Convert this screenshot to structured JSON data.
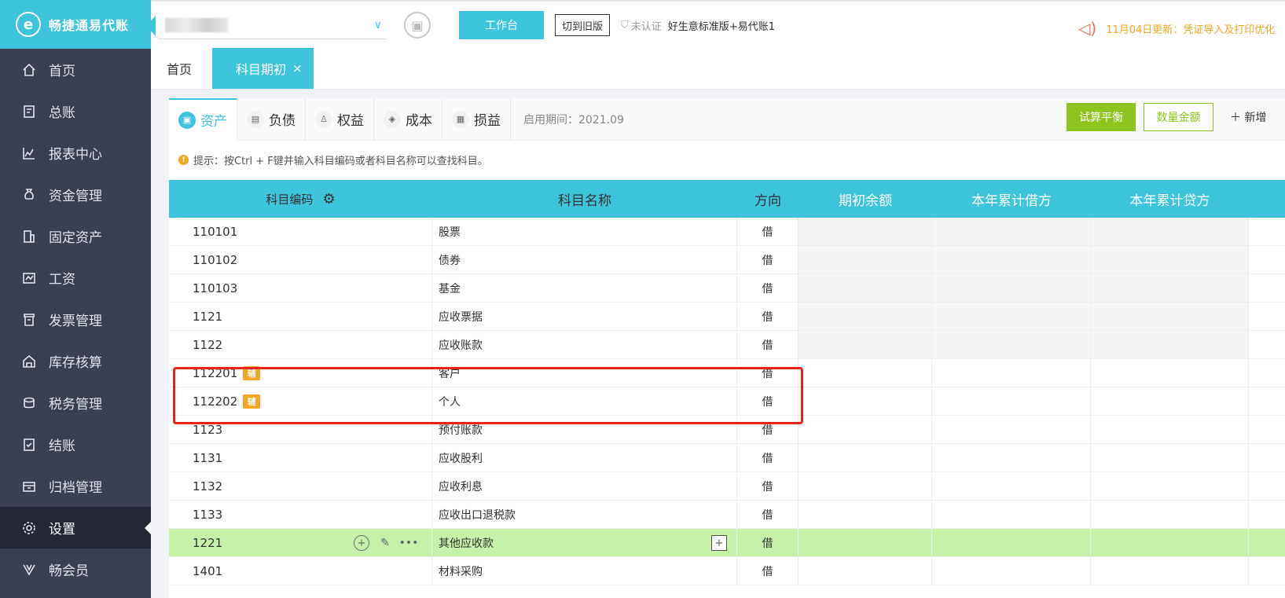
{
  "sidebar": {
    "brand": "畅捷通易代账",
    "items": [
      {
        "label": "首页"
      },
      {
        "label": "总账"
      },
      {
        "label": "报表中心"
      },
      {
        "label": "资金管理"
      },
      {
        "label": "固定资产"
      },
      {
        "label": "工资"
      },
      {
        "label": "发票管理"
      },
      {
        "label": "库存核算"
      },
      {
        "label": "税务管理"
      },
      {
        "label": "结账"
      },
      {
        "label": "归档管理"
      },
      {
        "label": "设置"
      },
      {
        "label": "畅会员"
      }
    ],
    "active_index": 11
  },
  "topbar": {
    "workbench_label": "工作台",
    "old_version_label": "切到旧版",
    "cert_label": "未认证",
    "plan_label": "好生意标准版+易代账1",
    "notice": "11月04日更新：凭证导入及打印优化"
  },
  "page_tabs": [
    {
      "label": "首页"
    },
    {
      "label": "科目期初",
      "close": "×"
    }
  ],
  "subtabs": [
    {
      "label": "资产",
      "icon": "▣"
    },
    {
      "label": "负债",
      "icon": "▤"
    },
    {
      "label": "权益",
      "icon": "♙"
    },
    {
      "label": "成本",
      "icon": "◈"
    },
    {
      "label": "损益",
      "icon": "▦"
    }
  ],
  "period_label": "启用期间：2021.09",
  "buttons": {
    "trial_balance": "试算平衡",
    "qty_amount": "数量金额",
    "add": "＋ 新增"
  },
  "tip": {
    "mark": "!",
    "text": "提示：按Ctrl + F键并输入科目编码或者科目名称可以查找科目。"
  },
  "table": {
    "headers": [
      "科目编码",
      "科目名称",
      "方向",
      "期初余额",
      "本年累计借方",
      "本年累计贷方"
    ],
    "aux_label": "辅",
    "rows": [
      {
        "code": "110101",
        "name": "股票",
        "dir": "借",
        "shaded": true
      },
      {
        "code": "110102",
        "name": "债券",
        "dir": "借",
        "shaded": true
      },
      {
        "code": "110103",
        "name": "基金",
        "dir": "借",
        "shaded": true
      },
      {
        "code": "1121",
        "name": "应收票据",
        "dir": "借",
        "shaded": true
      },
      {
        "code": "1122",
        "name": "应收账款",
        "dir": "借",
        "shaded": true
      },
      {
        "code": "112201",
        "name": "客户",
        "dir": "借",
        "aux": true
      },
      {
        "code": "112202",
        "name": "个人",
        "dir": "借",
        "aux": true
      },
      {
        "code": "1123",
        "name": "预付账款",
        "dir": "借"
      },
      {
        "code": "1131",
        "name": "应收股利",
        "dir": "借"
      },
      {
        "code": "1132",
        "name": "应收利息",
        "dir": "借"
      },
      {
        "code": "1133",
        "name": "应收出口退税款",
        "dir": "借"
      },
      {
        "code": "1221",
        "name": "其他应收款",
        "dir": "借",
        "highlight": true
      },
      {
        "code": "1401",
        "name": "材料采购",
        "dir": "借"
      }
    ]
  }
}
